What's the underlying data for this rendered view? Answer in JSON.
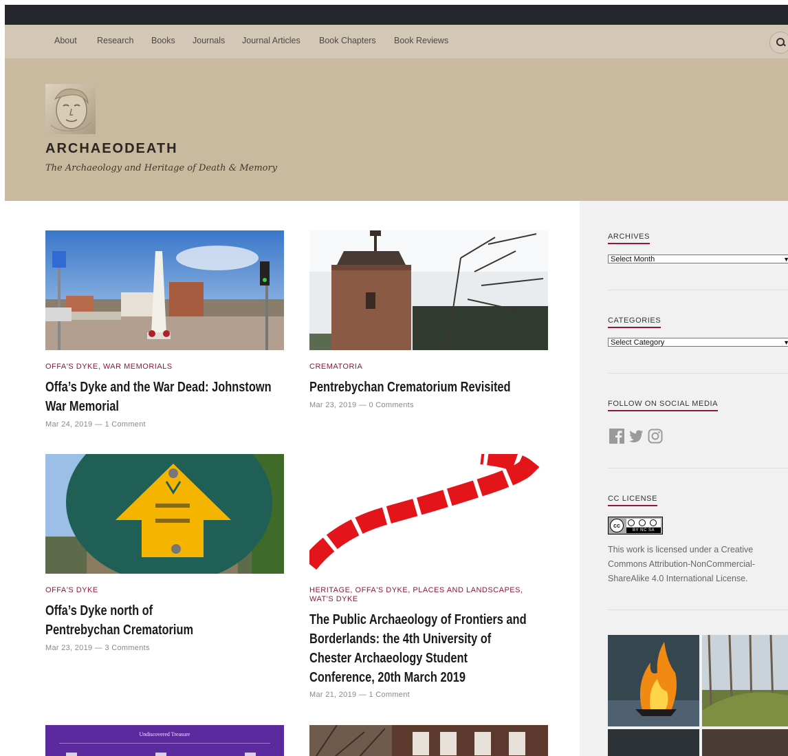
{
  "nav": {
    "items": [
      {
        "label": "About"
      },
      {
        "label": "Research"
      },
      {
        "label": "Books"
      },
      {
        "label": "Journals"
      },
      {
        "label": "Journal Articles"
      },
      {
        "label": "Book Chapters"
      },
      {
        "label": "Book Reviews"
      }
    ],
    "search_icon": "search-icon"
  },
  "site": {
    "title": "ARCHAEODEATH",
    "tagline": "The Archaeology and Heritage of Death & Memory"
  },
  "posts": [
    {
      "categories": [
        "OFFA'S DYKE",
        "WAR MEMORIALS"
      ],
      "title": "Offa’s Dyke and the War Dead: Johnstown War Memorial",
      "date": "Mar 24, 2019",
      "comments": "1 Comment"
    },
    {
      "categories": [
        "CREMATORIA"
      ],
      "title": "Pentrebychan Crematorium Revisited",
      "date": "Mar 23, 2019",
      "comments": "0 Comments"
    },
    {
      "categories": [
        "OFFA'S DYKE"
      ],
      "title": "Offa’s Dyke north of Pentrebychan Crematorium",
      "date": "Mar 23, 2019",
      "comments": "3 Comments"
    },
    {
      "categories": [
        "HERITAGE",
        "OFFA'S DYKE",
        "PLACES AND LANDSCAPES",
        "WAT'S DYKE"
      ],
      "title": "The Public Archaeology of Frontiers and Borderlands: the 4th University of Chester Archaeology Student Conference, 20th March 2019",
      "date": "Mar 21, 2019",
      "comments": "1 Comment"
    }
  ],
  "post_images": {
    "post5_banner": "Undiscovered Treasure"
  },
  "sidebar": {
    "archives": {
      "title": "ARCHIVES",
      "selected": "Select Month"
    },
    "categories": {
      "title": "CATEGORIES",
      "selected": "Select Category"
    },
    "social": {
      "title": "FOLLOW ON SOCIAL MEDIA",
      "icons": [
        "facebook-icon",
        "twitter-icon",
        "instagram-icon"
      ]
    },
    "license": {
      "title": "CC LICENSE",
      "badge_text": "BY NC SA",
      "text_before": "This work is licensed under a ",
      "link_text": "Creative Commons Attribution-NonCommercial-ShareAlike 4.0 International License",
      "text_after": "."
    }
  },
  "colors": {
    "topbar": "#24282c",
    "nav": "#d3c7b6",
    "header": "#c9b99f",
    "accent": "#8b1a36",
    "sidebar": "#f1f1f1"
  }
}
